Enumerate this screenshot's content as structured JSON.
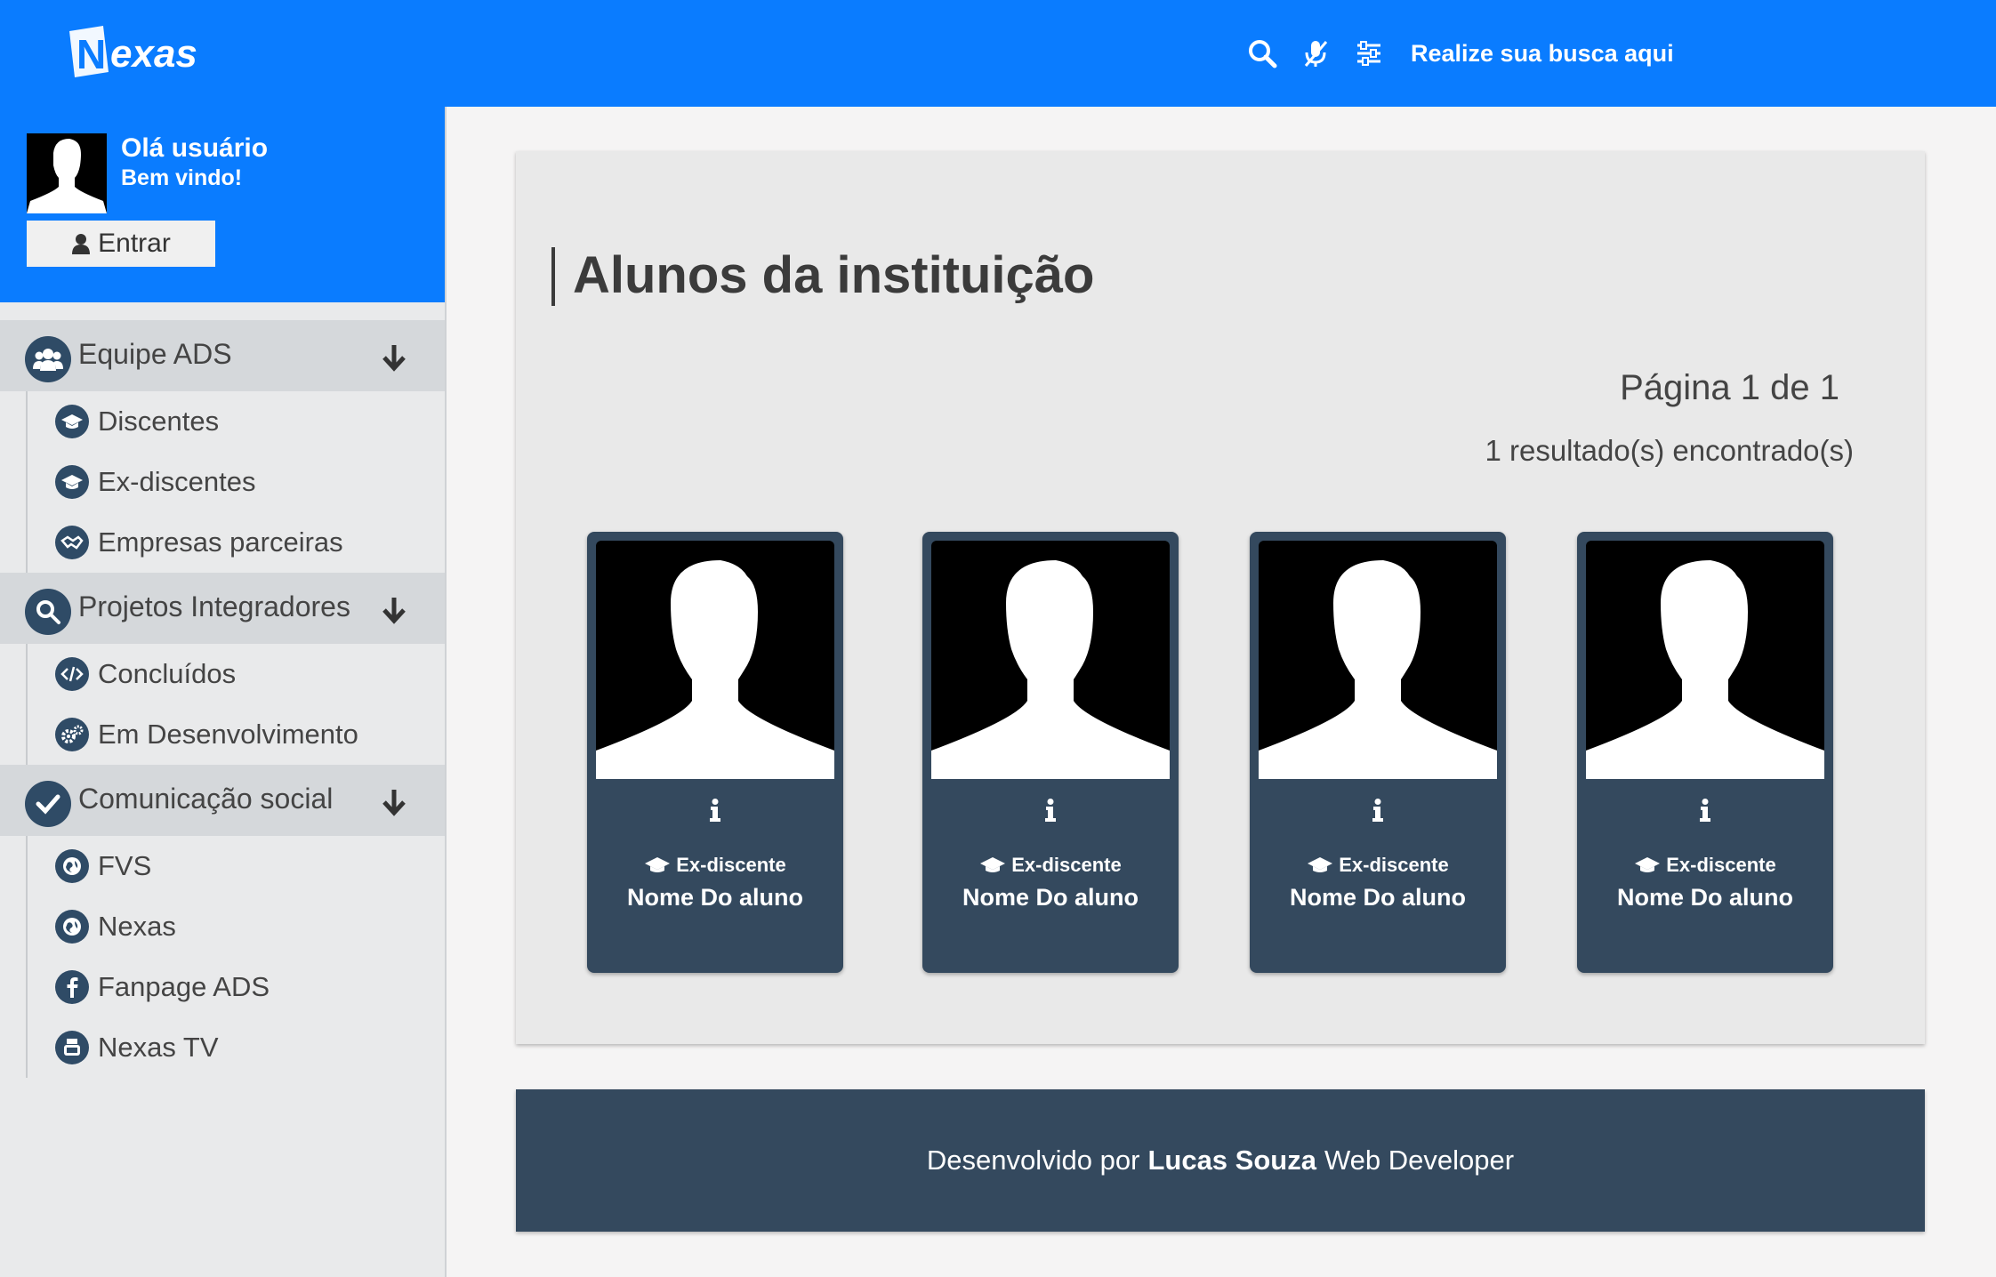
{
  "header": {
    "logo_text": "Nexas",
    "search_placeholder": "Realize sua busca aqui",
    "icons": [
      "search-icon",
      "microphone-off-icon",
      "filter-sliders-icon"
    ]
  },
  "user": {
    "greeting": "Olá usuário",
    "welcome": "Bem vindo!",
    "login_label": "Entrar"
  },
  "sidebar": {
    "sections": [
      {
        "label": "Equipe ADS",
        "icon": "users-icon",
        "items": [
          {
            "label": "Discentes",
            "icon": "graduation-cap-icon"
          },
          {
            "label": "Ex-discentes",
            "icon": "graduation-cap-icon"
          },
          {
            "label": "Empresas parceiras",
            "icon": "handshake-icon"
          }
        ]
      },
      {
        "label": "Projetos Integradores",
        "icon": "search-icon",
        "items": [
          {
            "label": "Concluídos",
            "icon": "code-icon"
          },
          {
            "label": "Em Desenvolvimento",
            "icon": "gears-icon"
          }
        ]
      },
      {
        "label": "Comunicação social",
        "icon": "check-icon",
        "items": [
          {
            "label": "FVS",
            "icon": "globe-icon"
          },
          {
            "label": "Nexas",
            "icon": "globe-icon"
          },
          {
            "label": "Fanpage ADS",
            "icon": "facebook-icon"
          },
          {
            "label": "Nexas TV",
            "icon": "youtube-icon"
          }
        ]
      }
    ]
  },
  "main": {
    "title": "Alunos da instituição",
    "page_info": "Página 1 de 1",
    "results": "1 resultado(s) encontrado(s)",
    "cards": [
      {
        "info": "i",
        "role": "Ex-discente",
        "name": "Nome Do aluno"
      },
      {
        "info": "i",
        "role": "Ex-discente",
        "name": "Nome Do aluno"
      },
      {
        "info": "i",
        "role": "Ex-discente",
        "name": "Nome Do aluno"
      },
      {
        "info": "i",
        "role": "Ex-discente",
        "name": "Nome Do aluno"
      }
    ]
  },
  "footer": {
    "prefix": "Desenvolvido por",
    "author": "Lucas Souza",
    "suffix": "Web Developer"
  },
  "colors": {
    "primary": "#0a7cff",
    "dark": "#34495e",
    "sidebar_bg": "#e9eaeb",
    "section_bg": "#d5d8db"
  }
}
